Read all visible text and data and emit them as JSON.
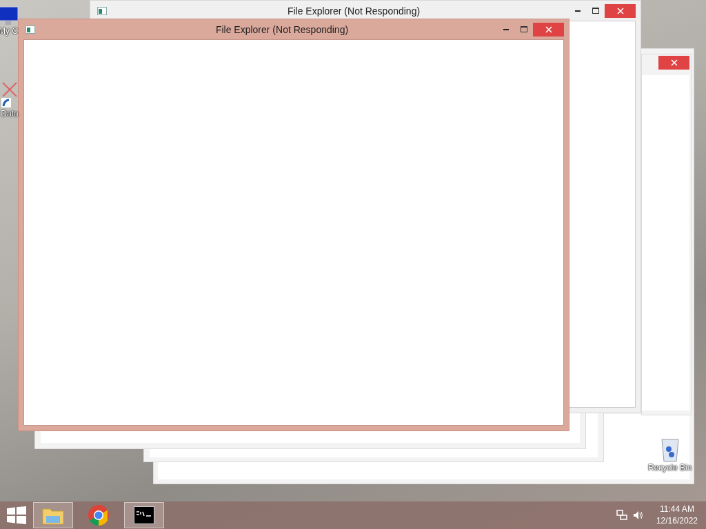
{
  "desktop_icons": [
    {
      "label": "My C",
      "kind": "computer"
    },
    {
      "label": "Data",
      "kind": "shortcut"
    },
    {
      "label": "Recycle Bin",
      "kind": "recycle"
    }
  ],
  "windows": [
    {
      "title": "File Explorer (Not Responding)",
      "focused": false
    },
    {
      "title": "File Explorer (Not Responding)",
      "focused": true
    }
  ],
  "taskbar": {
    "apps": [
      {
        "kind": "explorer",
        "running": true
      },
      {
        "kind": "chrome",
        "running": false
      },
      {
        "kind": "terminal",
        "running": true
      }
    ],
    "clock": {
      "time": "11:44 AM",
      "date": "12/16/2022"
    }
  }
}
